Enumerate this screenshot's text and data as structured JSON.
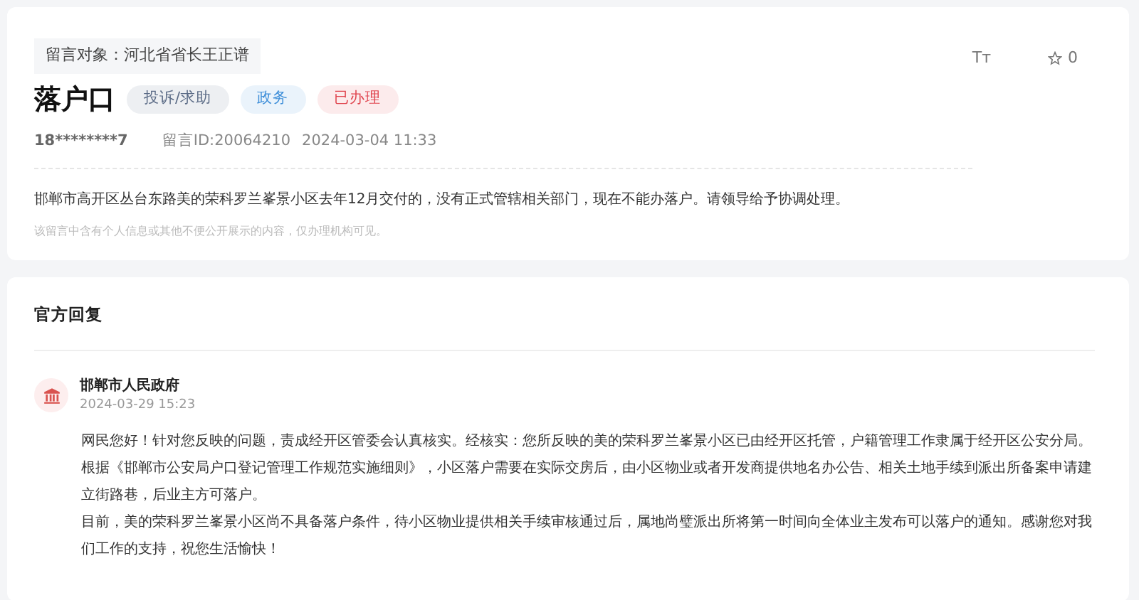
{
  "message": {
    "target": "留言对象：河北省省长王正谱",
    "title": "落户口",
    "tags": [
      {
        "label": "投诉/求助",
        "color": "#5b6b86"
      },
      {
        "label": "政务",
        "color": "#3f8fd9"
      },
      {
        "label": "已办理",
        "color": "#e0454f"
      }
    ],
    "author": "18********7",
    "id": "留言ID:20064210",
    "time": "2024-03-04 11:33",
    "font_size_button": "Tт",
    "likes": "0",
    "body": "邯郸市高开区丛台东路美的荣科罗兰峯景小区去年12月交付的，没有正式管辖相关部门，现在不能办落户。请领导给予协调处理。",
    "notice": "该留言中含有个人信息或其他不便公开展示的内容，仅办理机构可见。"
  },
  "reply": {
    "heading": "官方回复",
    "agency": "邯郸市人民政府",
    "time": "2024-03-29 15:23",
    "paragraphs": [
      "网民您好！针对您反映的问题，责成经开区管委会认真核实。经核实：您所反映的美的荣科罗兰峯景小区已由经开区托管，户籍管理工作隶属于经开区公安分局。根据《邯郸市公安局户口登记管理工作规范实施细则》，小区落户需要在实际交房后，由小区物业或者开发商提供地名办公告、相关土地手续到派出所备案申请建立街路巷，后业主方可落户。",
      "目前，美的荣科罗兰峯景小区尚不具备落户条件，待小区物业提供相关手续审核通过后，属地尚璧派出所将第一时间向全体业主发布可以落户的通知。感谢您对我们工作的支持，祝您生活愉快！"
    ]
  }
}
